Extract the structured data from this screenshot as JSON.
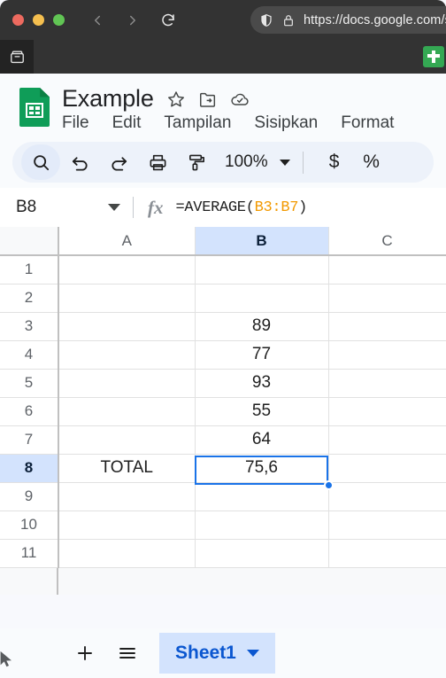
{
  "browser": {
    "url": "https://docs.google.com/sp",
    "nav_back_icon": "chevron-left-icon",
    "nav_forward_icon": "chevron-right-icon",
    "reload_icon": "reload-icon",
    "shield_icon": "shield-icon",
    "lock_icon": "lock-icon",
    "side_tab_icon": "archive-box-icon",
    "favicon": "google-sheets-favicon"
  },
  "document": {
    "title": "Example",
    "star_icon": "star-icon",
    "move_icon": "move-to-folder-icon",
    "cloud_icon": "cloud-saved-icon",
    "logo": "google-sheets-logo"
  },
  "menubar": {
    "items": [
      {
        "label": "File"
      },
      {
        "label": "Edit"
      },
      {
        "label": "Tampilan"
      },
      {
        "label": "Sisipkan"
      },
      {
        "label": "Format"
      }
    ]
  },
  "toolbar": {
    "search_icon": "search-icon",
    "undo_icon": "undo-icon",
    "redo_icon": "redo-icon",
    "print_icon": "print-icon",
    "paint_format_icon": "paint-format-icon",
    "zoom_value": "100%",
    "currency_label": "$",
    "percent_label": "%"
  },
  "formula_bar": {
    "name_box": "B8",
    "fx_label": "fx",
    "formula_prefix": "=AVERAGE(",
    "formula_ref": "B3:B7",
    "formula_suffix": ")"
  },
  "grid": {
    "columns": [
      "A",
      "B",
      "C"
    ],
    "selected_column": "B",
    "selected_row": 8,
    "selected_cell": "B8",
    "rows": [
      {
        "num": "1",
        "a": "",
        "b": "",
        "c": ""
      },
      {
        "num": "2",
        "a": "",
        "b": "",
        "c": ""
      },
      {
        "num": "3",
        "a": "",
        "b": "89",
        "c": ""
      },
      {
        "num": "4",
        "a": "",
        "b": "77",
        "c": ""
      },
      {
        "num": "5",
        "a": "",
        "b": "93",
        "c": ""
      },
      {
        "num": "6",
        "a": "",
        "b": "55",
        "c": ""
      },
      {
        "num": "7",
        "a": "",
        "b": "64",
        "c": ""
      },
      {
        "num": "8",
        "a": "TOTAL",
        "b": "75,6",
        "c": ""
      },
      {
        "num": "9",
        "a": "",
        "b": "",
        "c": ""
      },
      {
        "num": "10",
        "a": "",
        "b": "",
        "c": ""
      },
      {
        "num": "11",
        "a": "",
        "b": "",
        "c": ""
      }
    ]
  },
  "sheetbar": {
    "add_icon": "plus-icon",
    "all_sheets_icon": "hamburger-menu-icon",
    "active_tab": "Sheet1",
    "tab_caret_icon": "chevron-down-icon"
  },
  "colors": {
    "accent": "#1a73e8",
    "selection_header": "#d3e3fd",
    "sheets_green": "#0f9d58",
    "formula_ref": "#f29900",
    "toolbar_bg": "#edf2fa"
  }
}
